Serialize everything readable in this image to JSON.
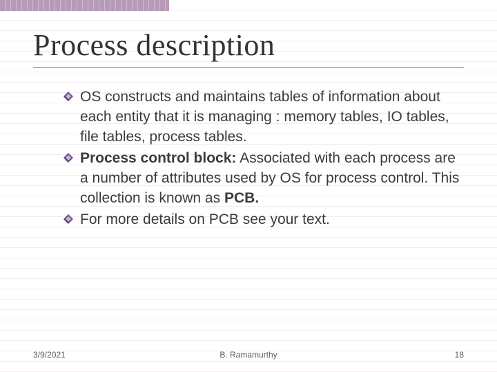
{
  "slide": {
    "title": "Process description",
    "bullets": [
      {
        "runs": [
          {
            "text": "OS constructs and maintains tables of information about each entity that it is managing : memory tables, IO tables, file tables, process tables.",
            "bold": false
          }
        ]
      },
      {
        "runs": [
          {
            "text": "Process control block:",
            "bold": true
          },
          {
            "text": " Associated with each process are a number of attributes used by OS for process control. This collection is known as ",
            "bold": false
          },
          {
            "text": "PCB.",
            "bold": true
          }
        ]
      },
      {
        "runs": [
          {
            "text": "For more details on PCB see your text.",
            "bold": false
          }
        ]
      }
    ],
    "footer": {
      "date": "3/9/2021",
      "author": "B. Ramamurthy",
      "page": "18"
    },
    "colors": {
      "accent": "#6a4f8a",
      "accent_light": "#b69bb8"
    }
  }
}
